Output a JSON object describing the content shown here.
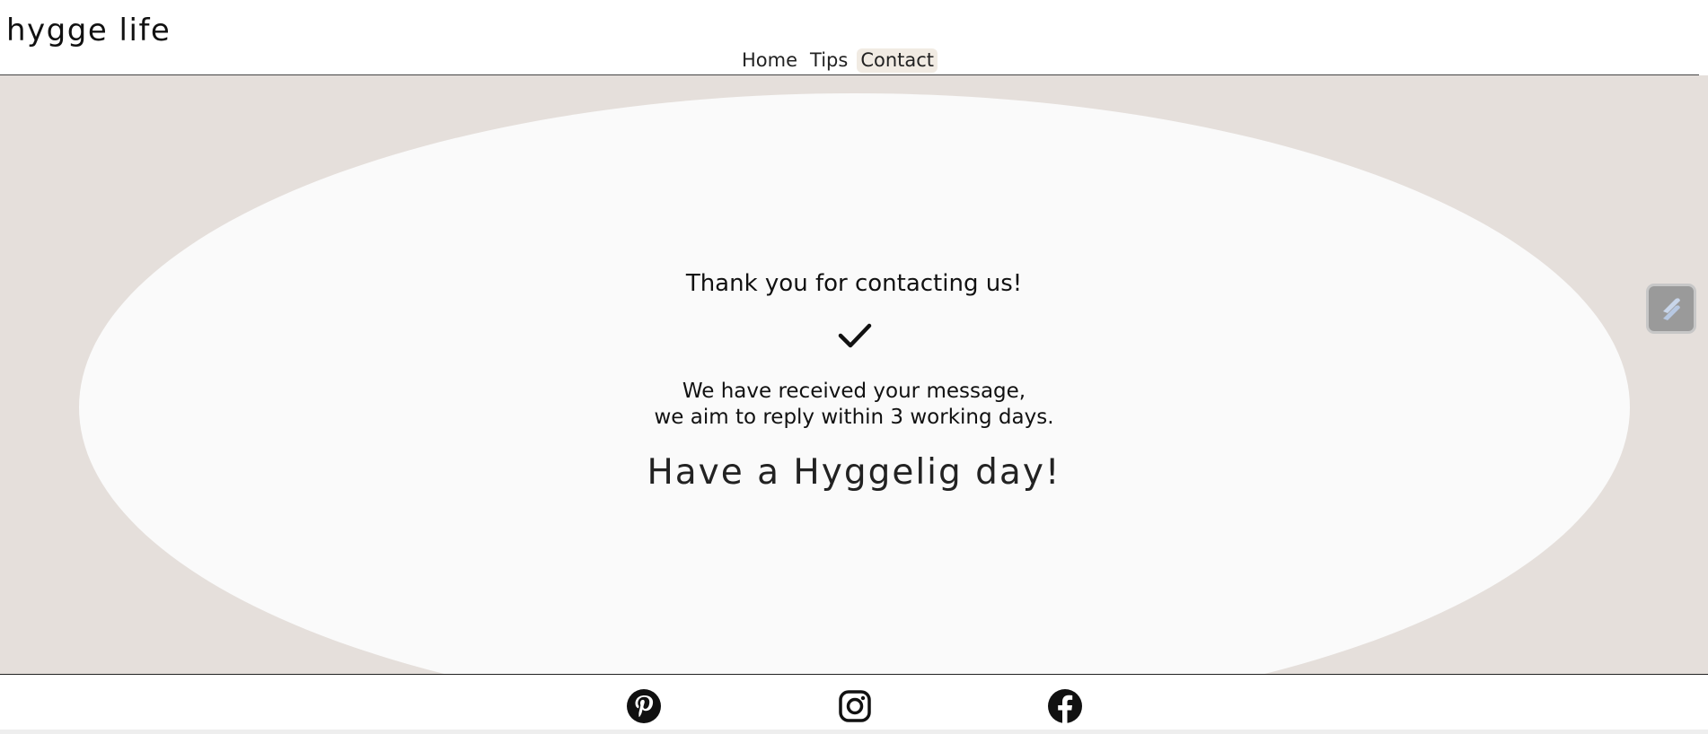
{
  "header": {
    "logo": "hygge life",
    "nav": [
      {
        "label": "Home",
        "active": false
      },
      {
        "label": "Tips",
        "active": false
      },
      {
        "label": "Contact",
        "active": true
      }
    ]
  },
  "main": {
    "heading": "Thank you for contacting us!",
    "check_icon": "checkmark-icon",
    "message_line1": "We have received your message,",
    "message_line2": "we aim to reply within 3 working days.",
    "closing": "Have a Hyggelig day!"
  },
  "widget": {
    "icon": "extension-icon"
  },
  "footer": {
    "social": [
      {
        "icon": "pinterest-icon"
      },
      {
        "icon": "instagram-icon"
      },
      {
        "icon": "facebook-icon"
      }
    ]
  },
  "colors": {
    "main_bg": "#e5dfdb",
    "card_bg": "#fafafa",
    "active_nav_bg": "#f1ebe3",
    "text": "#111111"
  }
}
